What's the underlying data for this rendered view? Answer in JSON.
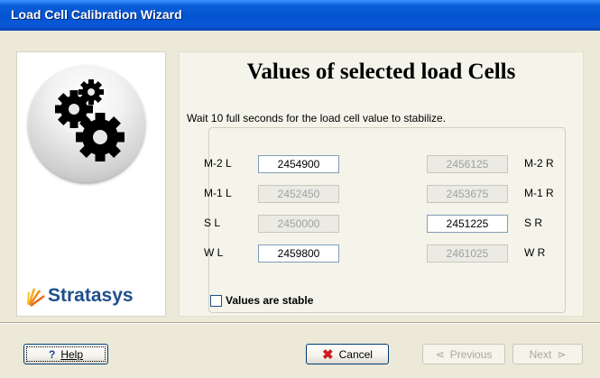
{
  "window": {
    "title": "Load Cell Calibration Wizard"
  },
  "branding": {
    "logo_text": "Stratasys",
    "gear_icon": "gears-icon",
    "logo_icon": "stratasys-burst-icon"
  },
  "main": {
    "heading": "Values of selected load Cells",
    "instruction": "Wait 10 full seconds for the load cell value to stabilize.",
    "left_cells": [
      {
        "label": "M-2 L",
        "value": "2454900",
        "enabled": true
      },
      {
        "label": "M-1 L",
        "value": "2452450",
        "enabled": false
      },
      {
        "label": "S L",
        "value": "2450000",
        "enabled": false
      },
      {
        "label": "W L",
        "value": "2459800",
        "enabled": true
      }
    ],
    "right_cells": [
      {
        "label": "M-2 R",
        "value": "2456125",
        "enabled": false
      },
      {
        "label": "M-1 R",
        "value": "2453675",
        "enabled": false
      },
      {
        "label": "S R",
        "value": "2451225",
        "enabled": true
      },
      {
        "label": "W R",
        "value": "2461025",
        "enabled": false
      }
    ],
    "stable_checkbox": {
      "label": "Values are stable",
      "checked": false
    }
  },
  "buttons": {
    "help": "Help",
    "cancel": "Cancel",
    "previous": "Previous",
    "next": "Next"
  },
  "colors": {
    "title_bar": "#0453cf",
    "logo_blue": "#1e4f8c",
    "cancel_icon": "#d11b1b"
  }
}
